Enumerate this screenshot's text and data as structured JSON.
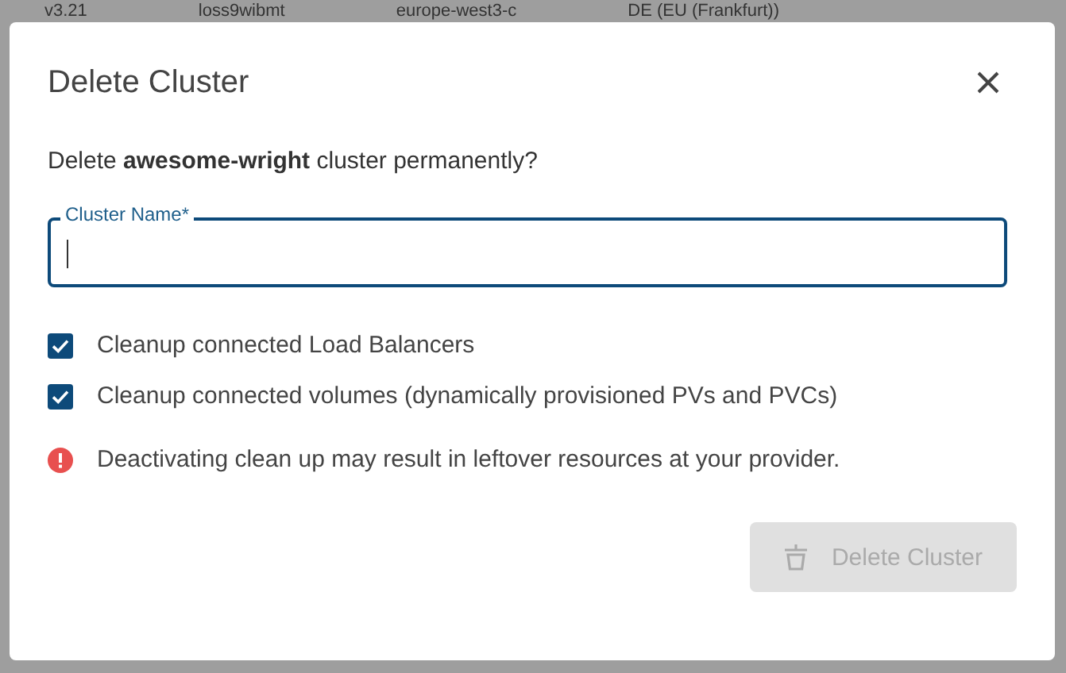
{
  "background": {
    "row": [
      "v3.21",
      "loss9wibmt",
      "europe-west3-c",
      "DE (EU (Frankfurt))"
    ]
  },
  "dialog": {
    "title": "Delete Cluster",
    "message": "Delete **awesome-wright** cluster permanently?",
    "field": {
      "label": "Cluster Name*",
      "focused": true
    },
    "options": [
      {
        "label": "Cleanup connected Load Balancers",
        "checked": true
      },
      {
        "label": "Cleanup connected volumes (dynamically provisioned PVs and PVCs)",
        "checked": true
      }
    ],
    "warning": "Deactivating clean up may result in leftover resources at your provider.",
    "button": {
      "label": "Delete Cluster",
      "disabled": true
    }
  }
}
